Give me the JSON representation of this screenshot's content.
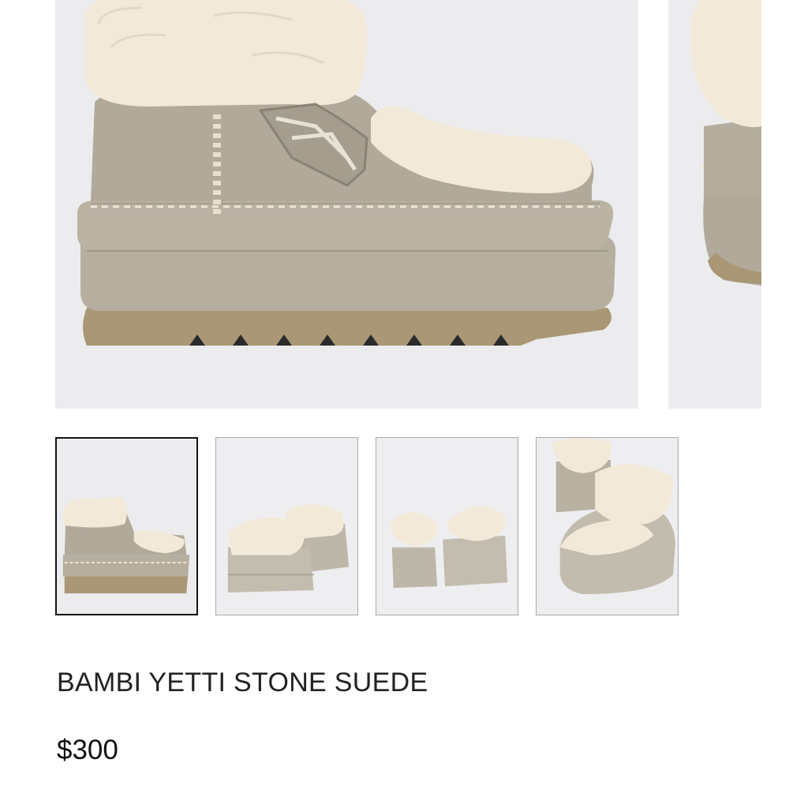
{
  "product": {
    "name": "BAMBI YETTI STONE SUEDE",
    "price": "$300"
  },
  "gallery": {
    "selected_index": 0,
    "thumbnails": [
      {
        "view": "side-view"
      },
      {
        "view": "front-pair-view"
      },
      {
        "view": "back-pair-view"
      },
      {
        "view": "top-angle-view"
      }
    ]
  },
  "colors": {
    "suede": "#b3ad9f",
    "fur": "#f1e6d6",
    "sole": "#a99775",
    "background": "#ececee"
  }
}
